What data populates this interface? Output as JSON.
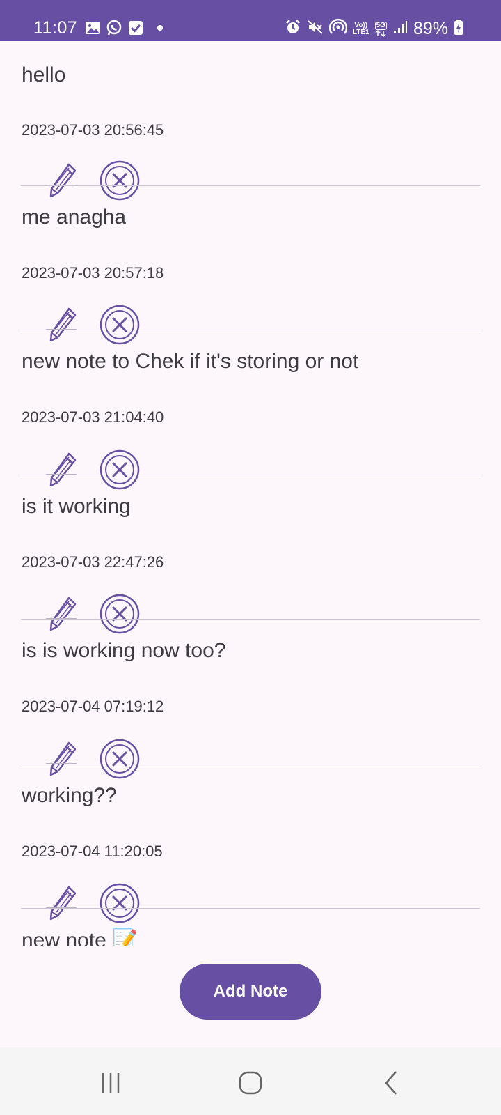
{
  "status_bar": {
    "time": "11:07",
    "battery_percent": "89%",
    "network_type": "5G",
    "volte_top": "Vo))",
    "volte_bottom": "LTE1",
    "left_icons": [
      "gallery-icon",
      "whatsapp-icon",
      "checkbox-icon",
      "dot-icon"
    ],
    "right_icons": [
      "alarm-icon",
      "mute-icon",
      "hotspot-icon",
      "volte-icon",
      "5g-icon",
      "signal-icon",
      "battery-charging-icon"
    ]
  },
  "notes": [
    {
      "text": "hello",
      "date": "2023-07-03 20:56:45"
    },
    {
      "text": "me anagha",
      "date": "2023-07-03 20:57:18"
    },
    {
      "text": "new note to Chek if it's storing or not",
      "date": "2023-07-03 21:04:40"
    },
    {
      "text": "is it working",
      "date": "2023-07-03 22:47:26"
    },
    {
      "text": "is is working now too?",
      "date": "2023-07-04 07:19:12"
    },
    {
      "text": "working??",
      "date": "2023-07-04 11:20:05"
    },
    {
      "text": "new note 📝",
      "date": ""
    }
  ],
  "add_note_label": "Add Note",
  "colors": {
    "primary": "#6750a4",
    "background": "#fdf7fb",
    "text": "#3d3a40",
    "divider": "#cac4d0",
    "nav_bar": "#f5f5f5"
  }
}
